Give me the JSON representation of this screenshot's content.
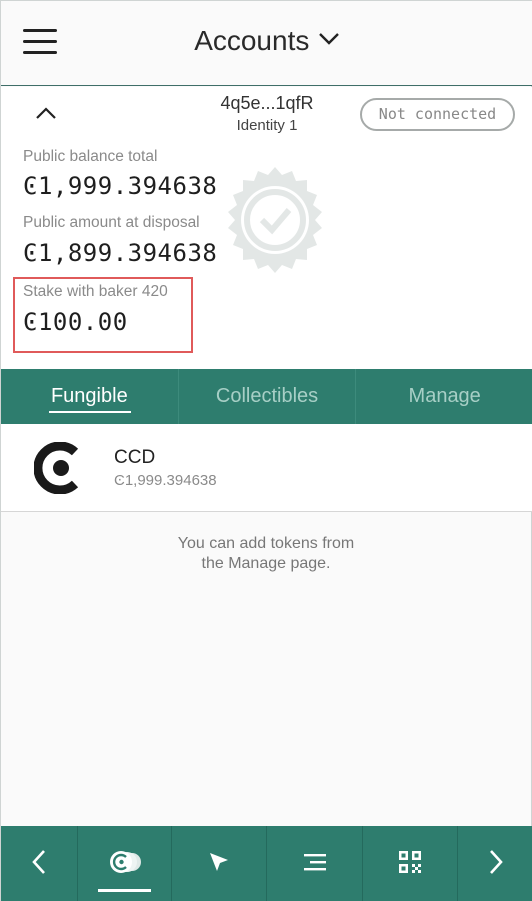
{
  "header": {
    "title": "Accounts"
  },
  "account": {
    "address": "4q5e...1qfR",
    "identity": "Identity 1",
    "connection_status": "Not connected",
    "public_balance_label": "Public balance total",
    "public_balance_value": "Ͼ1,999.394638",
    "at_disposal_label": "Public amount at disposal",
    "at_disposal_value": "Ͼ1,899.394638",
    "stake_label": "Stake with baker 420",
    "stake_value": "Ͼ100.00"
  },
  "tabs": [
    {
      "label": "Fungible",
      "active": true
    },
    {
      "label": "Collectibles",
      "active": false
    },
    {
      "label": "Manage",
      "active": false
    }
  ],
  "tokens": [
    {
      "name": "CCD",
      "balance": "Ͼ1,999.394638",
      "icon": "ccd-logo-icon"
    }
  ],
  "empty_note": {
    "line1": "You can add tokens from",
    "line2": "the Manage page."
  },
  "bottom_nav": {
    "items": [
      {
        "icon": "chevron-left-icon"
      },
      {
        "icon": "tokens-icon",
        "active": true
      },
      {
        "icon": "send-icon"
      },
      {
        "icon": "transaction-log-icon"
      },
      {
        "icon": "qr-code-icon"
      },
      {
        "icon": "chevron-right-icon"
      }
    ]
  },
  "colors": {
    "accent": "#2e7d6e",
    "highlight_box": "#e05a5a"
  }
}
